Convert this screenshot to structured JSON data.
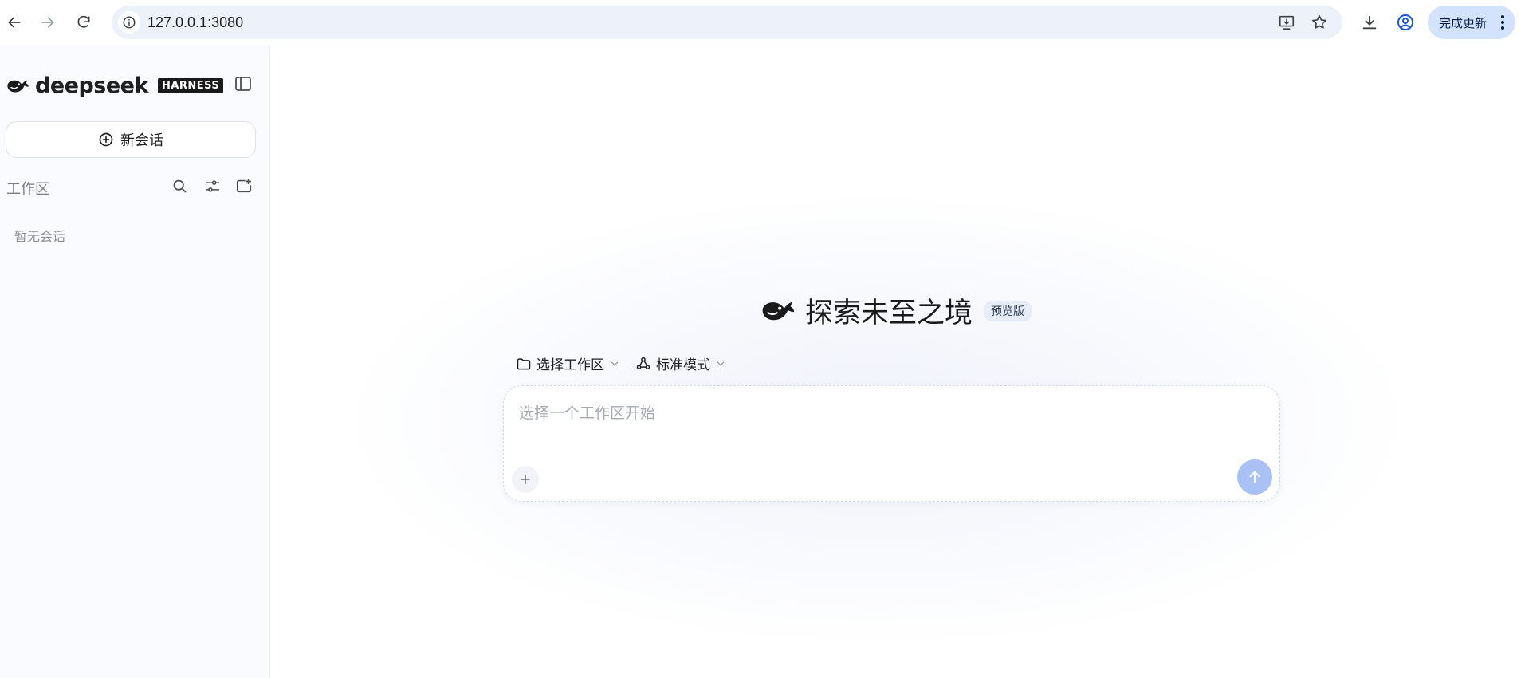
{
  "browser": {
    "url": "127.0.0.1:3080",
    "update_label": "完成更新",
    "icons": [
      "back-icon",
      "forward-icon",
      "reload-icon",
      "site-info-icon",
      "install-app-icon",
      "bookmark-star-icon",
      "download-icon",
      "profile-icon",
      "menu-dots-icon"
    ]
  },
  "sidebar": {
    "brand_name": "deepseek",
    "brand_badge": "HARNESS",
    "new_chat_label": "新会话",
    "workspace_label": "工作区",
    "empty_text": "暂无会话"
  },
  "main": {
    "hero_title": "探索未至之境",
    "hero_badge": "预览版",
    "workspace_selector": "选择工作区",
    "mode_selector": "标准模式",
    "composer_placeholder": "选择一个工作区开始"
  },
  "colors": {
    "accent_send": "#a9c1f5",
    "update_bg": "#d3e3fd",
    "sidebar_bg": "#f9fbff"
  }
}
